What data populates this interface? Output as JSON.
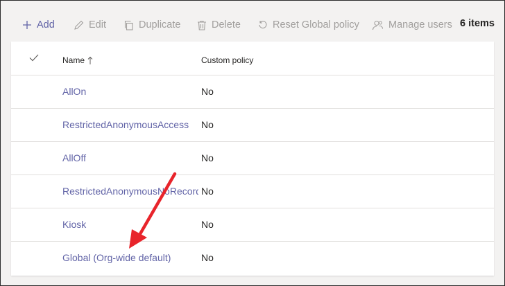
{
  "toolbar": {
    "add_label": "Add",
    "edit_label": "Edit",
    "duplicate_label": "Duplicate",
    "delete_label": "Delete",
    "reset_label": "Reset Global policy",
    "manage_users_label": "Manage users",
    "item_count": "6 items"
  },
  "table": {
    "columns": [
      "Name",
      "Custom policy"
    ],
    "rows": [
      {
        "name": "AllOn",
        "custom_policy": "No"
      },
      {
        "name": "RestrictedAnonymousAccess",
        "custom_policy": "No"
      },
      {
        "name": "AllOff",
        "custom_policy": "No"
      },
      {
        "name": "RestrictedAnonymousNoRecording",
        "custom_policy": "No"
      },
      {
        "name": "Kiosk",
        "custom_policy": "No"
      },
      {
        "name": "Global (Org-wide default)",
        "custom_policy": "No"
      }
    ]
  },
  "colors": {
    "accent": "#6264a7",
    "disabled": "#a19f9d",
    "annotation_arrow": "#e8242b"
  },
  "icons": [
    "plus-icon",
    "pencil-icon",
    "duplicate-icon",
    "trash-icon",
    "reset-icon",
    "manage-users-icon",
    "checkmark-icon",
    "sort-ascending-arrow-icon"
  ]
}
